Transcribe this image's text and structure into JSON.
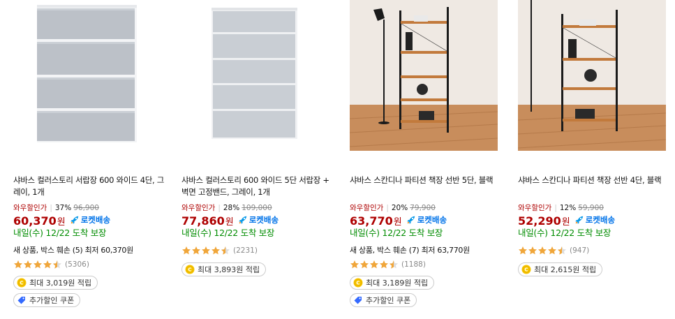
{
  "products": [
    {
      "name": "샤바스 컬러스토리 서랍장 600 와이드 4단, 그레이, 1개",
      "deal_label": "와우할인가",
      "discount": "37%",
      "original_price": "96,900",
      "price": "60,370",
      "currency": "원",
      "shipping_badge": "로켓배송",
      "delivery": "내일(수) 12/22 도착 보장",
      "used_offer": "새 상품, 박스 훼손 (5) 최저 60,370원",
      "rating": 4.5,
      "review_count": "(5306)",
      "cashback": "최대 3,019원 적립",
      "coupon": "추가할인 쿠폰"
    },
    {
      "name": "샤바스 컬러스토리 600 와이드 5단 서랍장 + 벽면 고정밴드, 그레이, 1개",
      "deal_label": "와우할인가",
      "discount": "28%",
      "original_price": "109,000",
      "price": "77,860",
      "currency": "원",
      "shipping_badge": "로켓배송",
      "delivery": "내일(수) 12/22 도착 보장",
      "rating": 4.5,
      "review_count": "(2231)",
      "cashback": "최대 3,893원 적립"
    },
    {
      "name": "샤바스 스칸디나 파티션 책장 선반 5단, 블랙",
      "deal_label": "와우할인가",
      "discount": "20%",
      "original_price": "79,900",
      "price": "63,770",
      "currency": "원",
      "shipping_badge": "로켓배송",
      "delivery": "내일(수) 12/22 도착 보장",
      "used_offer": "새 상품, 박스 훼손 (7) 최저 63,770원",
      "rating": 4.5,
      "review_count": "(1188)",
      "cashback": "최대 3,189원 적립",
      "coupon": "추가할인 쿠폰"
    },
    {
      "name": "샤바스 스칸디나 파티션 책장 선반 4단, 블랙",
      "deal_label": "와우할인가",
      "discount": "12%",
      "original_price": "59,900",
      "price": "52,290",
      "currency": "원",
      "shipping_badge": "로켓배송",
      "delivery": "내일(수) 12/22 도착 보장",
      "rating": 4.5,
      "review_count": "(947)",
      "cashback": "최대 2,615원 적립"
    }
  ],
  "colors": {
    "price_red": "#ae0000",
    "rocket_blue": "#0073e9",
    "delivery_green": "#008c00",
    "star_orange": "#f0a63a",
    "coin_yellow": "#f7c600"
  }
}
